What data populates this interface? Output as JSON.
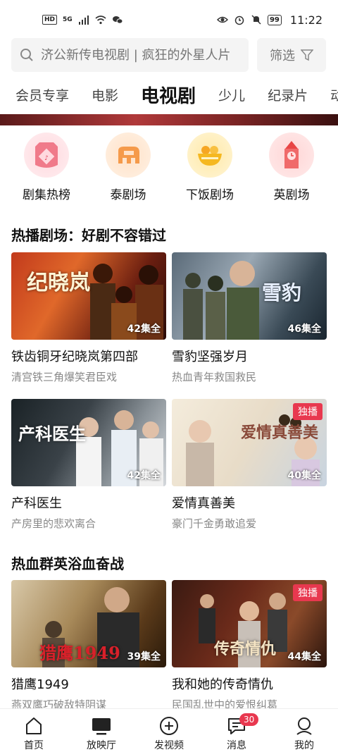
{
  "status_bar": {
    "hd": "HD",
    "signal": "5G",
    "battery": "99",
    "time": "11:22"
  },
  "search": {
    "placeholder": "济公新传电视剧 | 疯狂的外星人片",
    "filter_label": "筛选"
  },
  "tabs": [
    {
      "label": "会员专享",
      "active": false
    },
    {
      "label": "电影",
      "active": false
    },
    {
      "label": "电视剧",
      "active": true
    },
    {
      "label": "少儿",
      "active": false
    },
    {
      "label": "纪录片",
      "active": false
    },
    {
      "label": "动",
      "active": false
    }
  ],
  "categories": [
    {
      "label": "剧集热榜",
      "icon": "chart-icon"
    },
    {
      "label": "泰剧场",
      "icon": "elephant-icon"
    },
    {
      "label": "下饭剧场",
      "icon": "bowl-icon"
    },
    {
      "label": "英剧场",
      "icon": "bigben-icon"
    }
  ],
  "section1": {
    "title": "热播剧场：好剧不容错过",
    "cards": [
      {
        "title": "铁齿铜牙纪晓岚第四部",
        "subtitle": "清宫铁三角爆笑君臣戏",
        "episodes": "42集全",
        "poster_text": "纪晓岚",
        "exclusive": ""
      },
      {
        "title": "雪豹坚强岁月",
        "subtitle": "热血青年救国救民",
        "episodes": "46集全",
        "poster_text": "雪豹",
        "exclusive": ""
      },
      {
        "title": "产科医生",
        "subtitle": "产房里的悲欢离合",
        "episodes": "42集全",
        "poster_text": "产科医生",
        "exclusive": ""
      },
      {
        "title": "爱情真善美",
        "subtitle": "豪门千金勇敢追爱",
        "episodes": "40集全",
        "poster_text": "爱情真善美",
        "exclusive": "独播"
      }
    ]
  },
  "section2": {
    "title": "热血群英浴血奋战",
    "cards": [
      {
        "title": "猎鹰1949",
        "subtitle": "燕双鹰巧破敌特阴谋",
        "episodes": "39集全",
        "poster_text": "猎鹰1949",
        "exclusive": ""
      },
      {
        "title": "我和她的传奇情仇",
        "subtitle": "民国乱世中的爱恨纠葛",
        "episodes": "44集全",
        "poster_text": "传奇情仇",
        "exclusive": "独播"
      }
    ]
  },
  "bottom_nav": [
    {
      "label": "首页",
      "icon": "home-icon",
      "active": false
    },
    {
      "label": "放映厅",
      "icon": "tv-icon",
      "active": true
    },
    {
      "label": "发视频",
      "icon": "plus-circle-icon",
      "active": false
    },
    {
      "label": "消息",
      "icon": "message-icon",
      "active": false,
      "badge": "30"
    },
    {
      "label": "我的",
      "icon": "profile-icon",
      "active": false
    }
  ]
}
